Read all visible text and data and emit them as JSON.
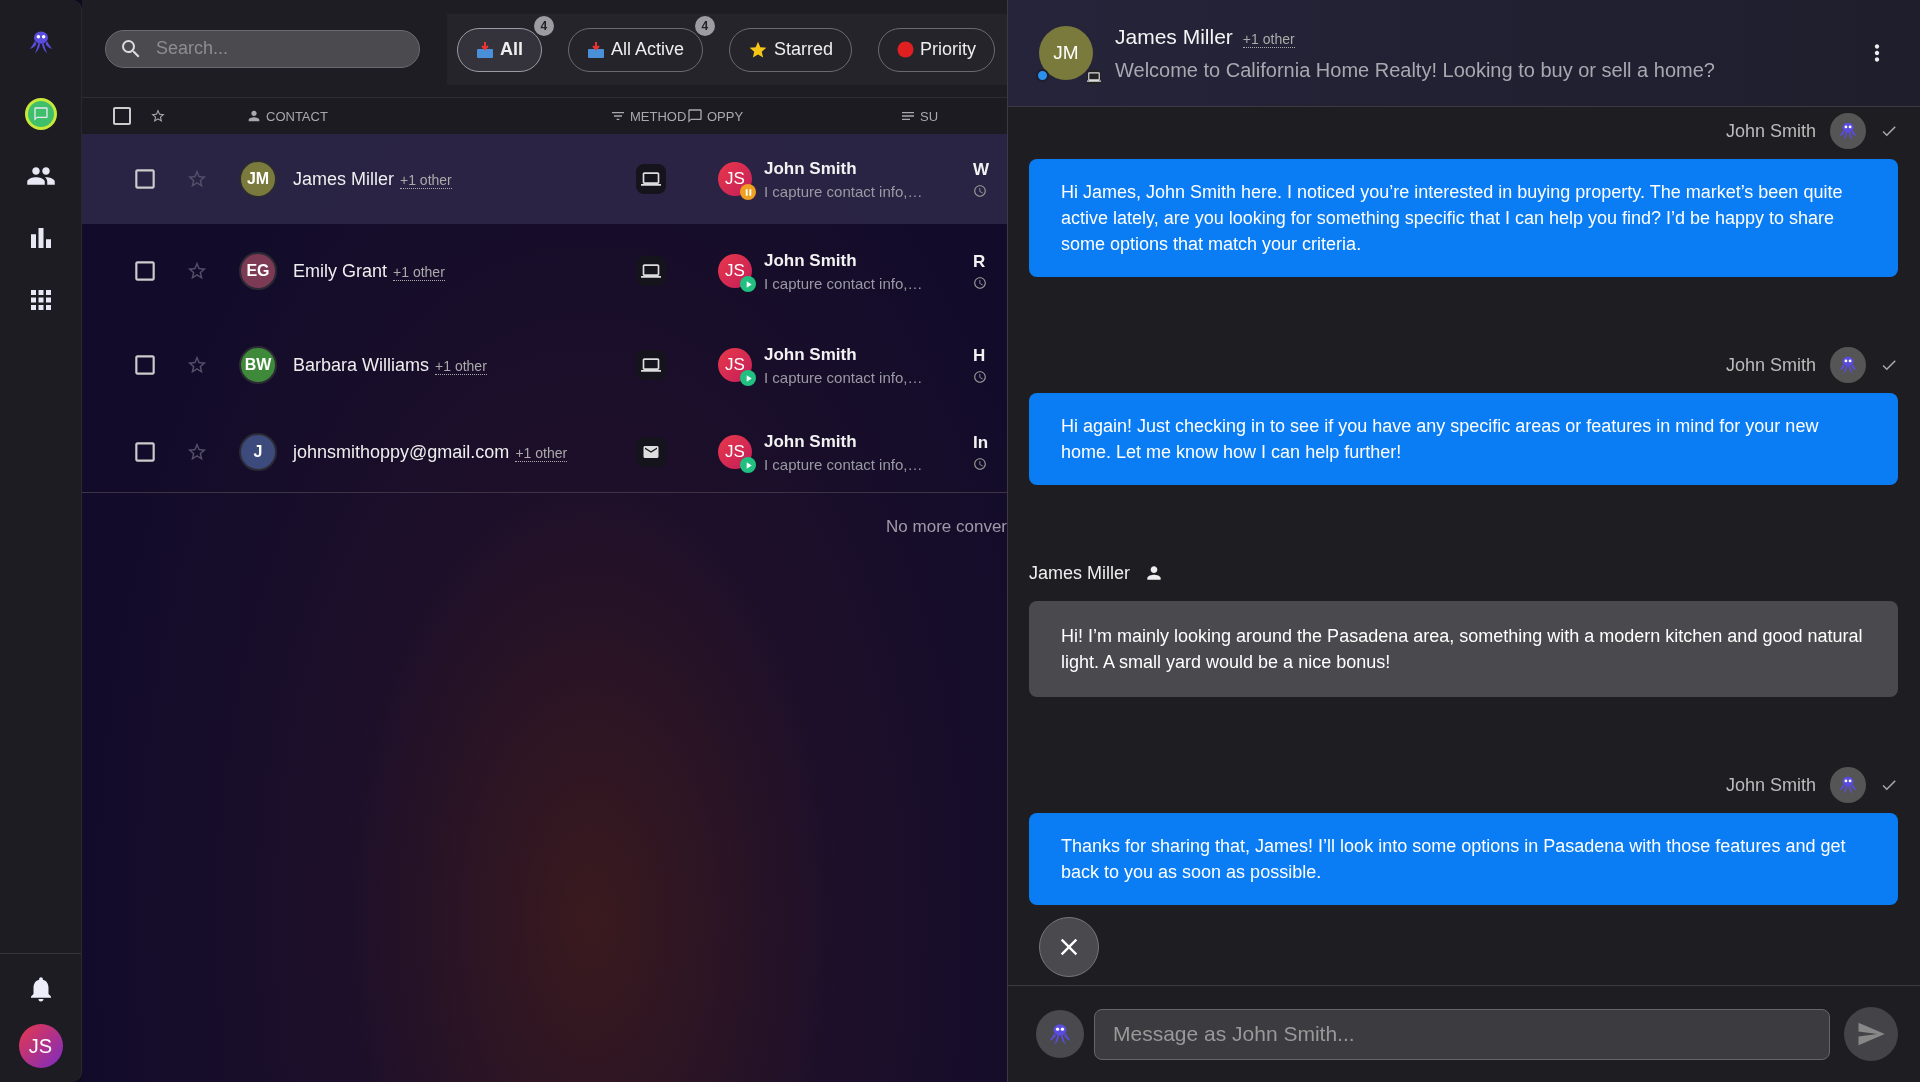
{
  "sidebar": {
    "items": [
      {
        "selected": false
      },
      {
        "selected": true
      },
      {
        "selected": false
      },
      {
        "selected": false
      },
      {
        "selected": false
      }
    ],
    "user": {
      "initials": "JS"
    }
  },
  "toolbar": {
    "search": {
      "placeholder": "Search..."
    },
    "filters": [
      {
        "label": "All",
        "count": "4",
        "selected": true
      },
      {
        "label": "All Active",
        "count": "4",
        "selected": false
      },
      {
        "label": "Starred",
        "selected": false
      },
      {
        "label": "Priority",
        "selected": false
      }
    ]
  },
  "table": {
    "select_all": {
      "checked": false
    },
    "columns": [
      {
        "label": "CONTACT"
      },
      {
        "label": "METHOD"
      },
      {
        "label": "OPPY"
      },
      {
        "label": "SU"
      }
    ],
    "rows": [
      {
        "selected": true,
        "checked": false,
        "starred": false,
        "initials": "JM",
        "color": "#7a7a3c",
        "name": "James Miller",
        "extra": "+1 other",
        "kind": "web",
        "agent_initials": "JS",
        "agent": "John Smith",
        "preview": "I capture contact info,…",
        "paused": true,
        "column_4": "W"
      },
      {
        "selected": false,
        "checked": false,
        "starred": false,
        "initials": "EG",
        "color": "#7d3a55",
        "name": "Emily Grant",
        "extra": "+1 other",
        "kind": "web",
        "agent_initials": "JS",
        "agent": "John Smith",
        "preview": "I capture contact info,…",
        "paused": false,
        "column_4": "R"
      },
      {
        "selected": false,
        "checked": false,
        "starred": false,
        "initials": "BW",
        "color": "#3f8a3a",
        "name": "Barbara Williams",
        "extra": "+1 other",
        "kind": "web",
        "agent_initials": "JS",
        "agent": "John Smith",
        "preview": "I capture contact info,…",
        "paused": false,
        "column_4": "H"
      },
      {
        "selected": false,
        "checked": false,
        "starred": false,
        "initials": "J",
        "color": "#3c4a7c",
        "name": "johnsmithoppy@gmail.com",
        "extra": "+1 other",
        "kind": "email",
        "agent_initials": "JS",
        "agent": "John Smith",
        "preview": "I capture contact info,…",
        "paused": false,
        "column_4": "In"
      }
    ],
    "footer": "No more conver"
  },
  "conversation": {
    "header": {
      "initials": "JM",
      "color": "#7a7a3c",
      "name": "James Miller",
      "extra": "+1 other",
      "subtitle": "Welcome to California Home Realty! Looking to buy or sell a home?"
    },
    "messages": [
      {
        "kind": "outgoing",
        "sender": "John Smith",
        "read": true,
        "text": "Hi James, John Smith here. I noticed you’re interested in buying property. The market’s been quite active lately, are you looking for something specific that I can help you find? I’d be happy to share some options that match your criteria."
      },
      {
        "kind": "outgoing",
        "sender": "John Smith",
        "read": true,
        "text": "Hi again! Just checking in to see if you have any specific areas or features in mind for your new home. Let me know how I can help further!"
      },
      {
        "kind": "incoming",
        "sender": "James Miller",
        "text": "Hi! I’m mainly looking around the Pasadena area, something with a modern kitchen and good natural light. A small yard would be a nice bonus!"
      },
      {
        "kind": "outgoing",
        "sender": "John Smith",
        "read": true,
        "text": "Thanks for sharing that, James! I’ll look into some options in Pasadena with those features and get back to you as soon as possible."
      }
    ],
    "composer": {
      "placeholder": "Message as John Smith..."
    }
  }
}
